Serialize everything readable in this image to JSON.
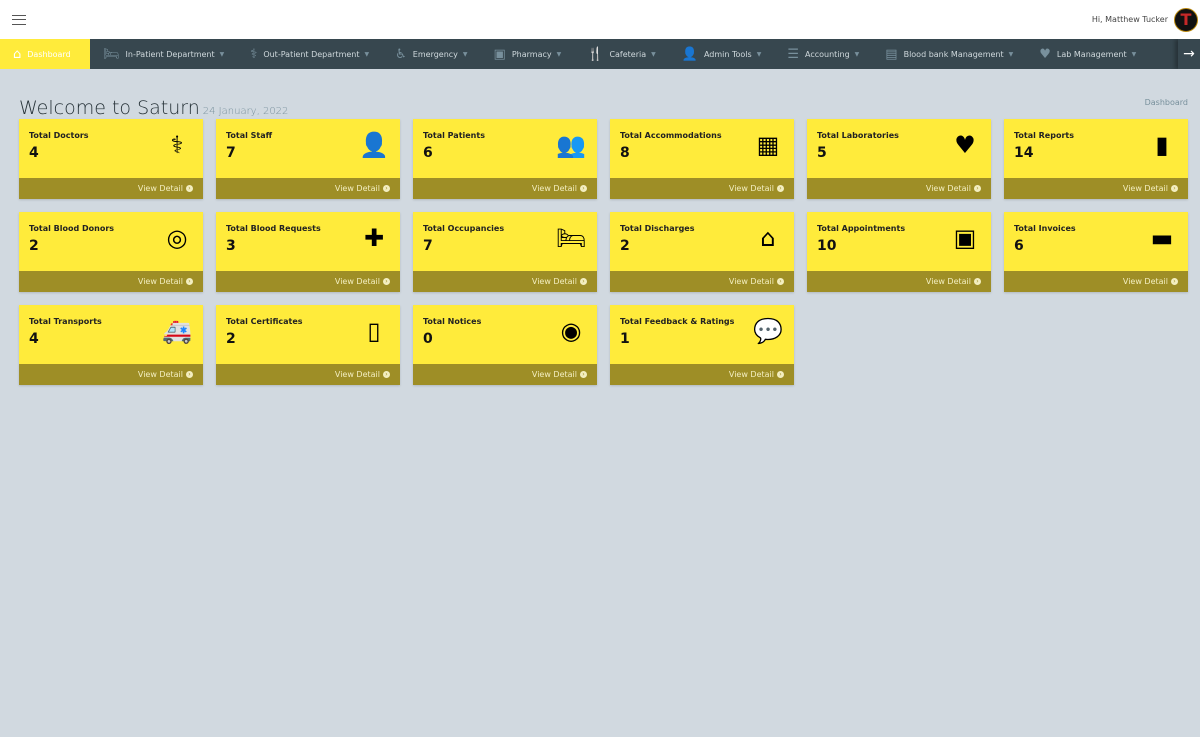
{
  "topbar": {
    "greeting": "Hi, Matthew Tucker",
    "avatar_letter": "T"
  },
  "nav": {
    "items": [
      {
        "label": "Dashboard",
        "icon": "home-icon",
        "glyph": "⌂",
        "active": true,
        "dropdown": false
      },
      {
        "label": "In-Patient Department",
        "icon": "bed-icon",
        "glyph": "🛏",
        "dropdown": true
      },
      {
        "label": "Out-Patient Department",
        "icon": "stethoscope-icon",
        "glyph": "⚕",
        "dropdown": true
      },
      {
        "label": "Emergency",
        "icon": "wheelchair-icon",
        "glyph": "♿",
        "dropdown": true
      },
      {
        "label": "Pharmacy",
        "icon": "medkit-icon",
        "glyph": "▣",
        "dropdown": true
      },
      {
        "label": "Cafeteria",
        "icon": "utensils-icon",
        "glyph": "🍴",
        "dropdown": true
      },
      {
        "label": "Admin Tools",
        "icon": "user-icon",
        "glyph": "👤",
        "dropdown": true
      },
      {
        "label": "Accounting",
        "icon": "list-icon",
        "glyph": "☰",
        "dropdown": true
      },
      {
        "label": "Blood bank Management",
        "icon": "hospital-icon",
        "glyph": "▤",
        "dropdown": true
      },
      {
        "label": "Lab Management",
        "icon": "heartbeat-icon",
        "glyph": "♥",
        "dropdown": true
      }
    ],
    "scroll_arrow": "→"
  },
  "header": {
    "title": "Welcome to Saturn",
    "date": "24 January, 2022",
    "breadcrumb": "Dashboard"
  },
  "colors": {
    "card": "#ffeb3b",
    "card_footer": "#9e8e26",
    "nav": "#37474f",
    "background": "#d1d9e0"
  },
  "cards": [
    {
      "label": "Total Doctors",
      "value": "4",
      "icon": "doctor-icon",
      "glyph": "⚕",
      "link": "View Detail"
    },
    {
      "label": "Total Staff",
      "value": "7",
      "icon": "user-icon",
      "glyph": "👤",
      "link": "View Detail"
    },
    {
      "label": "Total Patients",
      "value": "6",
      "icon": "users-icon",
      "glyph": "👥",
      "link": "View Detail"
    },
    {
      "label": "Total Accommodations",
      "value": "8",
      "icon": "building-icon",
      "glyph": "▦",
      "link": "View Detail"
    },
    {
      "label": "Total Laboratories",
      "value": "5",
      "icon": "heartbeat-icon",
      "glyph": "♥",
      "link": "View Detail"
    },
    {
      "label": "Total Reports",
      "value": "14",
      "icon": "file-icon",
      "glyph": "▮",
      "link": "View Detail"
    },
    {
      "label": "Total Blood Donors",
      "value": "2",
      "icon": "life-ring-icon",
      "glyph": "◎",
      "link": "View Detail"
    },
    {
      "label": "Total Blood Requests",
      "value": "3",
      "icon": "hospital-icon",
      "glyph": "✚",
      "link": "View Detail"
    },
    {
      "label": "Total Occupancies",
      "value": "7",
      "icon": "bed-icon",
      "glyph": "🛏",
      "link": "View Detail"
    },
    {
      "label": "Total Discharges",
      "value": "2",
      "icon": "home-icon",
      "glyph": "⌂",
      "link": "View Detail"
    },
    {
      "label": "Total Appointments",
      "value": "10",
      "icon": "address-book-icon",
      "glyph": "▣",
      "link": "View Detail"
    },
    {
      "label": "Total Invoices",
      "value": "6",
      "icon": "credit-card-icon",
      "glyph": "▬",
      "link": "View Detail"
    },
    {
      "label": "Total Transports",
      "value": "4",
      "icon": "ambulance-icon",
      "glyph": "🚑",
      "link": "View Detail"
    },
    {
      "label": "Total Certificates",
      "value": "2",
      "icon": "id-badge-icon",
      "glyph": "▯",
      "link": "View Detail"
    },
    {
      "label": "Total Notices",
      "value": "0",
      "icon": "podcast-icon",
      "glyph": "◉",
      "link": "View Detail"
    },
    {
      "label": "Total Feedback & Ratings",
      "value": "1",
      "icon": "comments-icon",
      "glyph": "💬",
      "link": "View Detail"
    }
  ]
}
